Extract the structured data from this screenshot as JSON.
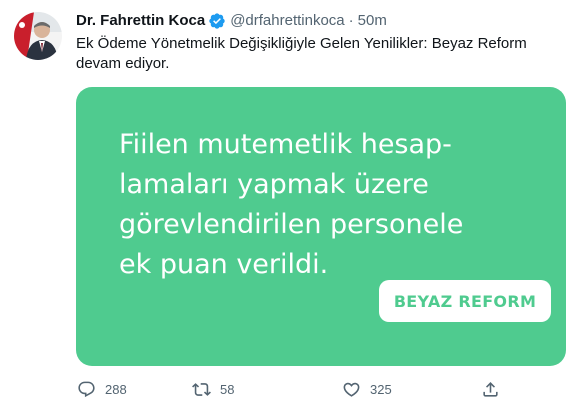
{
  "tweet": {
    "author": {
      "name": "Dr. Fahrettin Koca",
      "handle": "@drfahrettinkoca",
      "verified": true
    },
    "separator": "·",
    "time": "50m",
    "text": "Ek Ödeme Yönetmelik Değişikliğiyle Gelen Yenilikler: Beyaz Reform devam ediyor.",
    "card": {
      "headline": "Fiilen mutemetlik hesap-\nlamaları yapmak üzere\ngörevlendirilen personele\nek puan verildi.",
      "badge": "BEYAZ REFORM",
      "background_color": "#4fcb8f"
    },
    "actions": {
      "reply": {
        "icon": "reply-icon",
        "count": "288"
      },
      "retweet": {
        "icon": "retweet-icon",
        "count": "58"
      },
      "like": {
        "icon": "heart-icon",
        "count": "325"
      },
      "share": {
        "icon": "share-icon",
        "count": ""
      }
    }
  },
  "colors": {
    "text_primary": "#0f1419",
    "text_secondary": "#536471",
    "verified_blue": "#1d9bf0",
    "card_green": "#4fcb8f"
  }
}
